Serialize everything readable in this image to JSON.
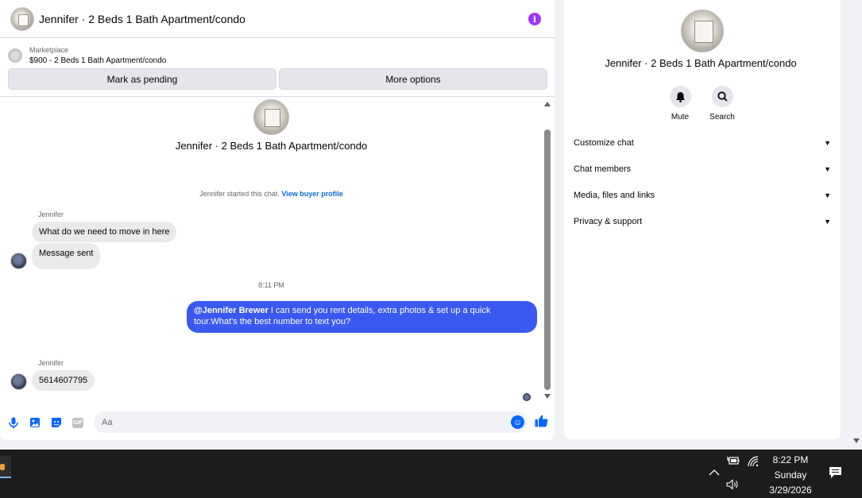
{
  "header": {
    "title": "Jennifer · 2 Beds 1 Bath Apartment/condo",
    "info_icon": "info-icon"
  },
  "marketplace": {
    "label": "Marketplace",
    "listing": "$900 - 2 Beds 1 Bath Apartment/condo"
  },
  "actions": {
    "mark_pending": "Mark as pending",
    "more_options": "More options"
  },
  "conversation": {
    "title": "Jennifer · 2 Beds 1 Bath Apartment/condo",
    "started_text": "Jennifer started this chat.",
    "buyer_profile_link": "View buyer profile",
    "sender_1": "Jennifer",
    "msg_1": "What do we need to move in here",
    "msg_2": "Message sent",
    "timestamp": "8:11 PM",
    "out_mention": "@Jennifer Brewer",
    "out_text": " I can send you rent details, extra photos & set up a quick tour.What's the best number to text you?",
    "sender_2": "Jennifer",
    "msg_3": "5614607795"
  },
  "composer": {
    "placeholder": "Aa"
  },
  "info_panel": {
    "title": "Jennifer · 2 Beds 1 Bath Apartment/condo",
    "mute_label": "Mute",
    "search_label": "Search",
    "sections": [
      "Customize chat",
      "Chat members",
      "Media, files and links",
      "Privacy & support"
    ]
  },
  "taskbar": {
    "time": "8:22 PM",
    "day": "Sunday",
    "date": "3/29/2026"
  },
  "colors": {
    "accent": "#0866ff",
    "outgoing_bubble": "#3a59f0",
    "info_icon": "#a033ff"
  }
}
